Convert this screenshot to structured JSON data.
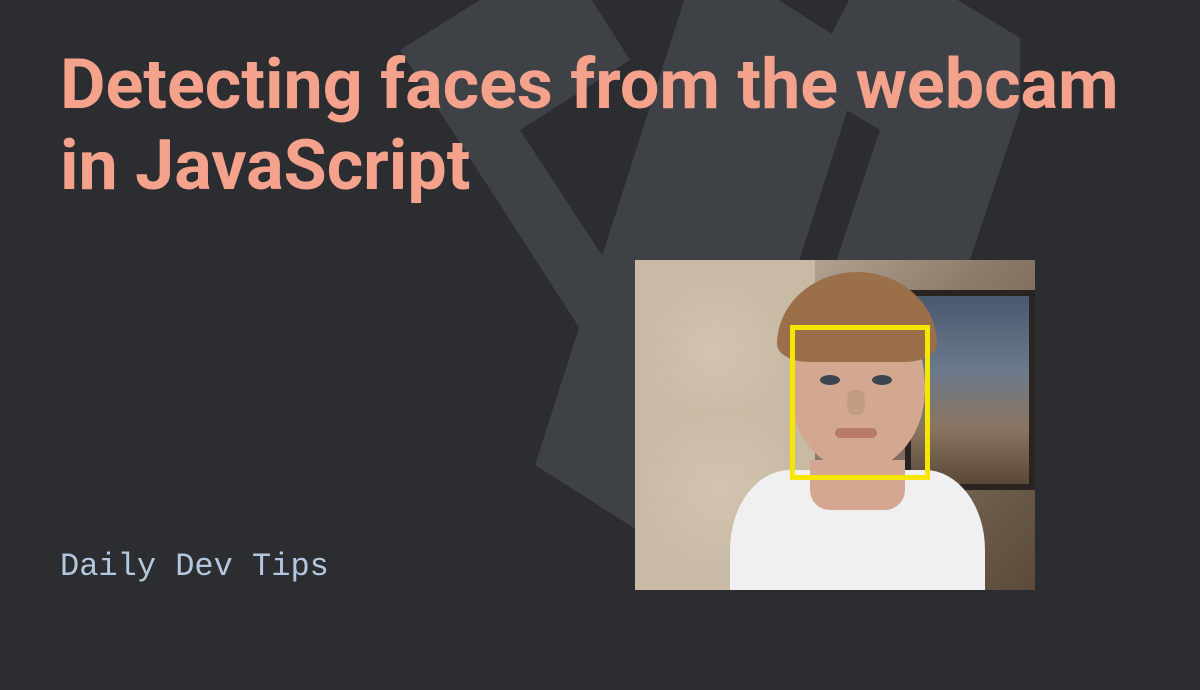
{
  "card": {
    "title": "Detecting faces from the webcam in JavaScript",
    "site_name": "Daily Dev Tips"
  },
  "colors": {
    "background": "#2b2d31",
    "shape": "#3e4146",
    "title": "#f5a28c",
    "site_name": "#b3c8dc",
    "detection_box": "#f7e600"
  },
  "detection": {
    "face_box": {
      "visible": true
    }
  }
}
